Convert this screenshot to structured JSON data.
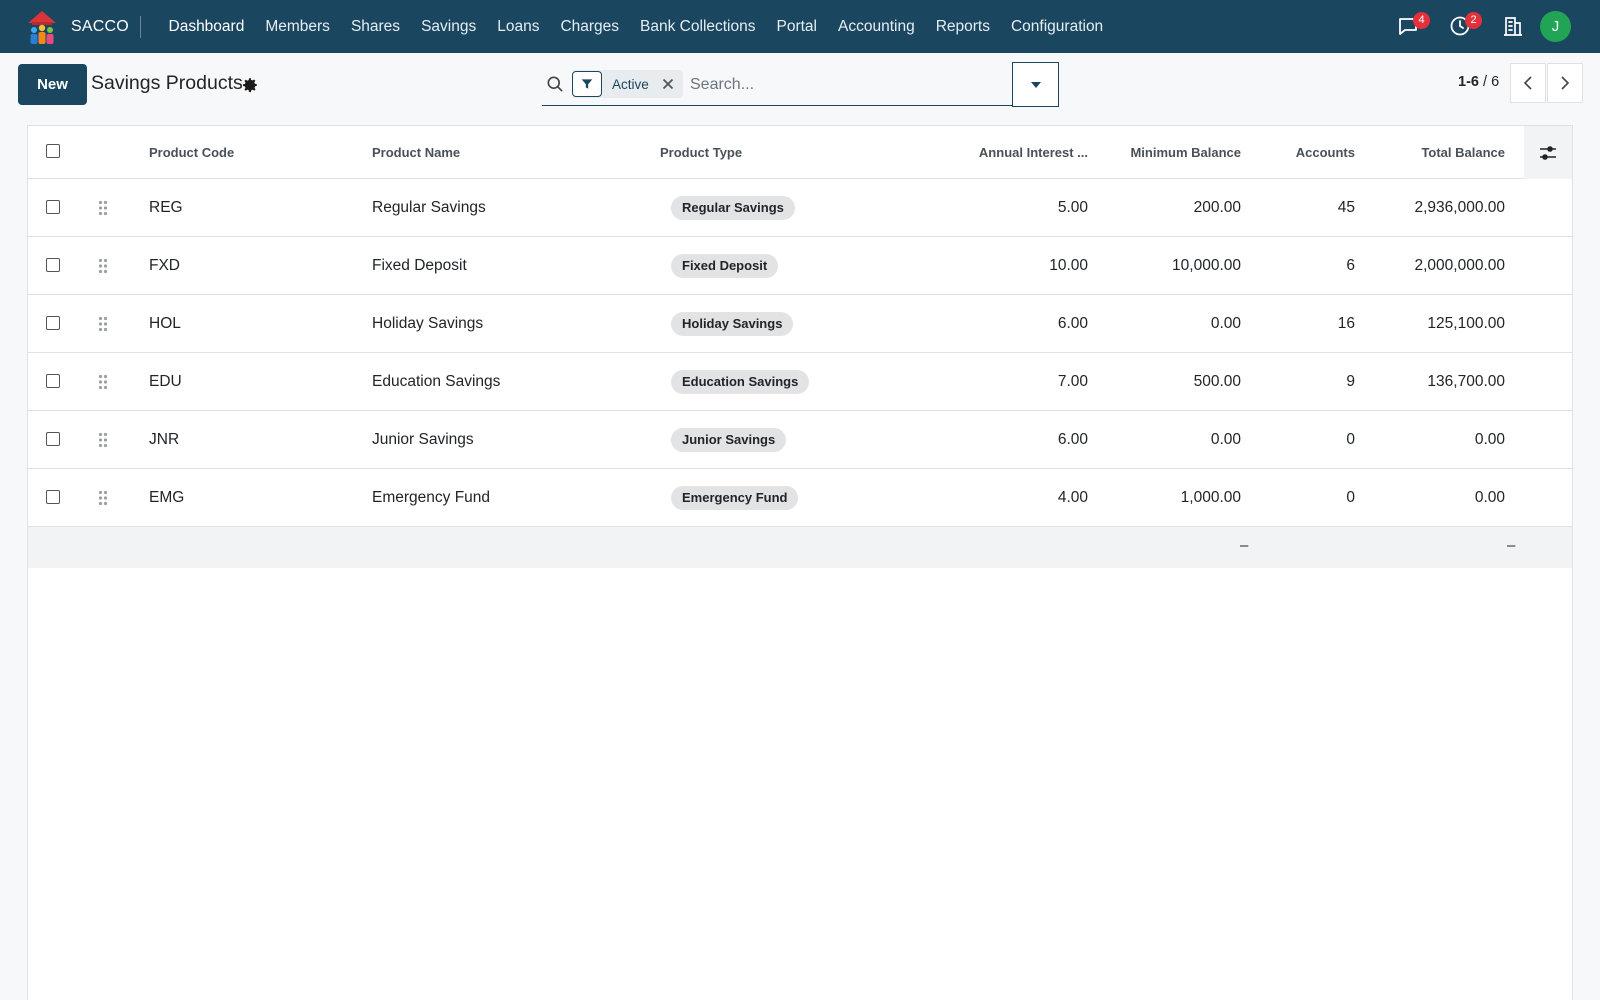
{
  "navbar": {
    "brand": "SACCO",
    "menu": [
      "Dashboard",
      "Members",
      "Shares",
      "Savings",
      "Loans",
      "Charges",
      "Bank Collections",
      "Portal",
      "Accounting",
      "Reports",
      "Configuration"
    ],
    "messages_badge": "4",
    "activities_badge": "2",
    "avatar_initial": "J"
  },
  "control": {
    "new_label": "New",
    "title": "Savings Products",
    "search": {
      "facet_label": "Active",
      "placeholder": "Search..."
    },
    "pager": {
      "range": "1-6",
      "separator": "/",
      "total": "6"
    }
  },
  "list": {
    "headers": {
      "code": "Product Code",
      "name": "Product Name",
      "type": "Product Type",
      "interest": "Annual Interest ...",
      "min_balance": "Minimum Balance",
      "accounts": "Accounts",
      "total_balance": "Total Balance"
    },
    "rows": [
      {
        "code": "REG",
        "name": "Regular Savings",
        "type": "Regular Savings",
        "interest": "5.00",
        "min_balance": "200.00",
        "accounts": "45",
        "total_balance": "2,936,000.00"
      },
      {
        "code": "FXD",
        "name": "Fixed Deposit",
        "type": "Fixed Deposit",
        "interest": "10.00",
        "min_balance": "10,000.00",
        "accounts": "6",
        "total_balance": "2,000,000.00"
      },
      {
        "code": "HOL",
        "name": "Holiday Savings",
        "type": "Holiday Savings",
        "interest": "6.00",
        "min_balance": "0.00",
        "accounts": "16",
        "total_balance": "125,100.00"
      },
      {
        "code": "EDU",
        "name": "Education Savings",
        "type": "Education Savings",
        "interest": "7.00",
        "min_balance": "500.00",
        "accounts": "9",
        "total_balance": "136,700.00"
      },
      {
        "code": "JNR",
        "name": "Junior Savings",
        "type": "Junior Savings",
        "interest": "6.00",
        "min_balance": "0.00",
        "accounts": "0",
        "total_balance": "0.00"
      },
      {
        "code": "EMG",
        "name": "Emergency Fund",
        "type": "Emergency Fund",
        "interest": "4.00",
        "min_balance": "1,000.00",
        "accounts": "0",
        "total_balance": "0.00"
      }
    ],
    "footer": {
      "accounts_total": "–",
      "balance_total": "–"
    }
  }
}
